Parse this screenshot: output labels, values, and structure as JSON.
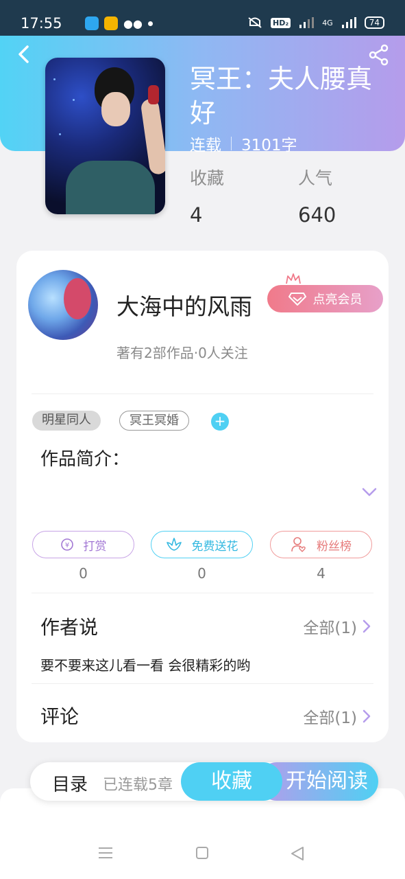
{
  "status_bar": {
    "time": "17:55",
    "hd_label": "HD₂",
    "network": "4G",
    "battery": "74"
  },
  "book": {
    "title": "冥王：夫人腰真好",
    "status": "连载",
    "word_count": "3101字",
    "favorites_label": "收藏",
    "favorites_value": "4",
    "popularity_label": "人气",
    "popularity_value": "640"
  },
  "author": {
    "name": "大海中的风雨",
    "vip_button": "点亮会员",
    "subtitle": "著有2部作品·0人关注"
  },
  "tags": [
    "明星同人",
    "冥王冥婚"
  ],
  "intro_label": "作品简介：",
  "actions": [
    {
      "label": "打赏",
      "count": "0"
    },
    {
      "label": "免费送花",
      "count": "0"
    },
    {
      "label": "粉丝榜",
      "count": "4"
    }
  ],
  "author_said": {
    "title": "作者说",
    "all_label": "全部(1)",
    "text": "要不要来这儿看一看 会很精彩的哟"
  },
  "comments": {
    "title": "评论",
    "all_label": "全部(1)"
  },
  "bottom_bar": {
    "toc_label": "目录",
    "toc_sub": "已连载5章",
    "favorite_button": "收藏",
    "read_button": "开始阅读"
  },
  "colors": {
    "accent_blue": "#4fd0f3",
    "accent_purple": "#b59ceb"
  }
}
